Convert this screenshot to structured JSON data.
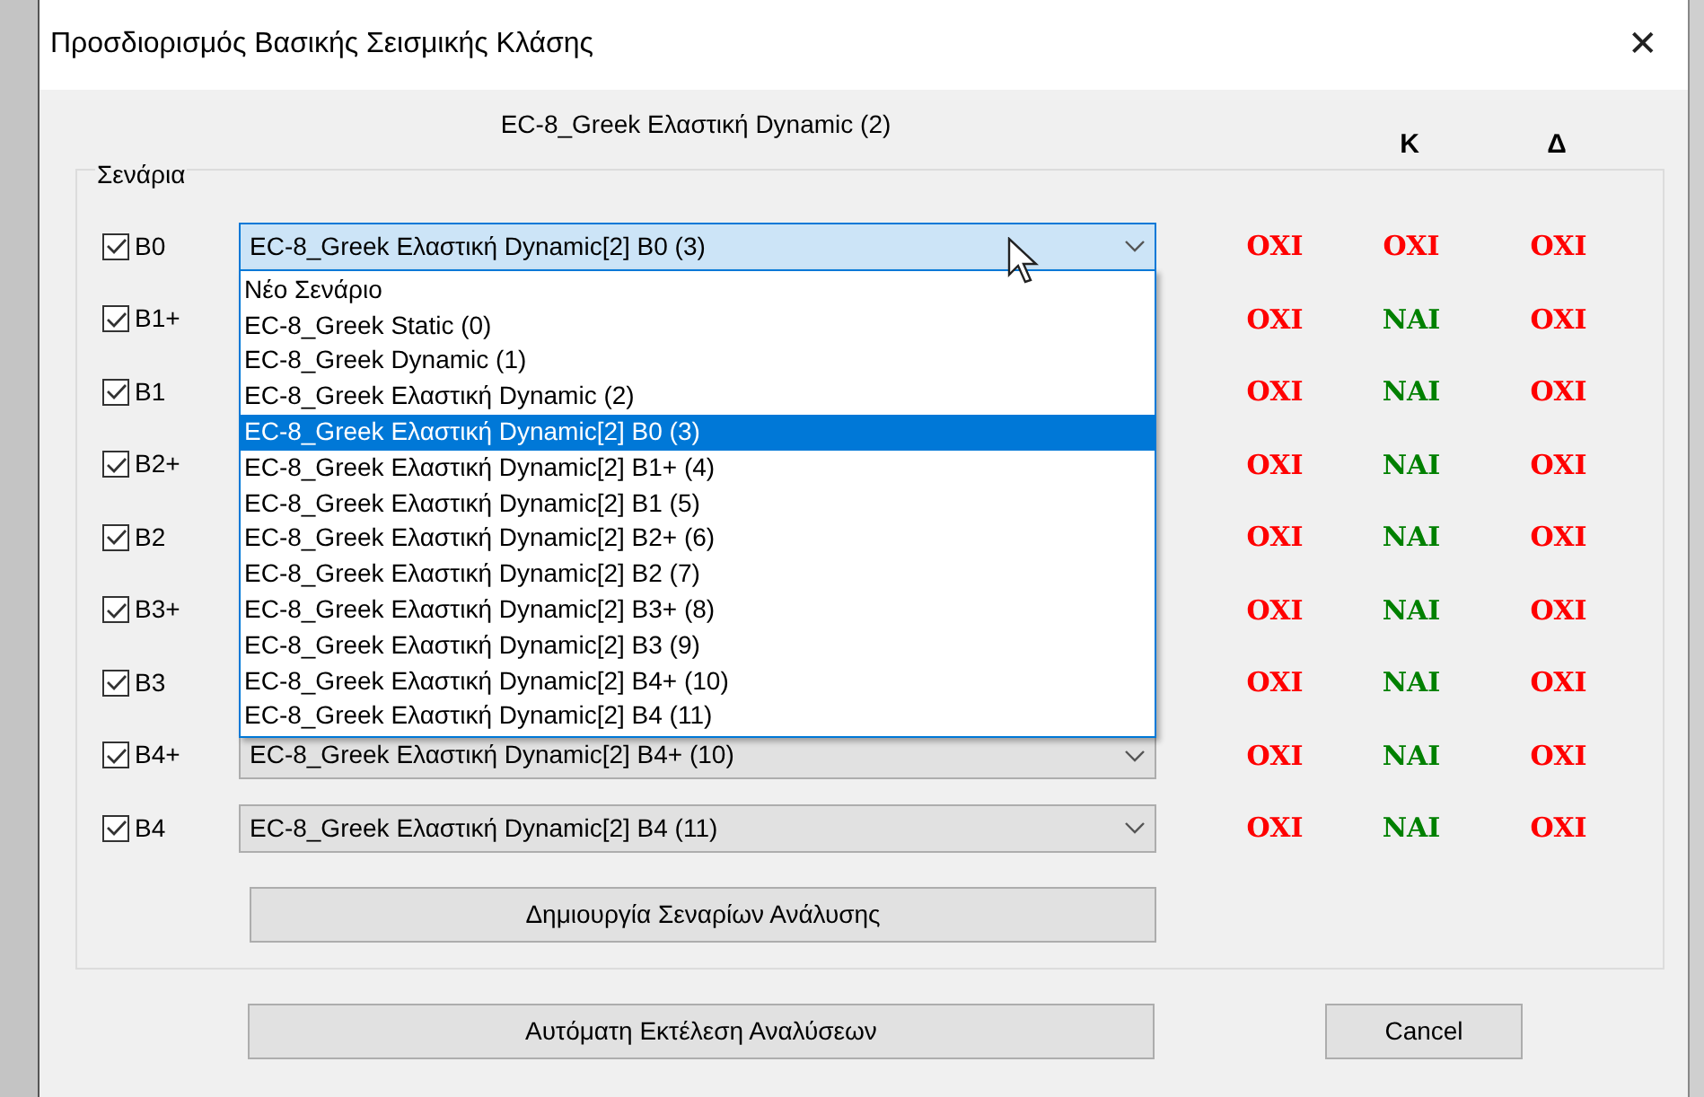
{
  "window": {
    "title": "Προσδιορισμός Βασικής Σεισμικής Κλάσης",
    "close": "✕"
  },
  "scenario_header": "EC-8_Greek Ελαστική Dynamic (2)",
  "columns": {
    "column_2": "Κ",
    "column_3": "Δ"
  },
  "group": {
    "label": "Σενάρια"
  },
  "rows": [
    {
      "label": "B0",
      "checked": true,
      "combo": "EC-8_Greek Ελαστική Dynamic[2] B0 (3)",
      "combo_open": true,
      "values": [
        {
          "text": "OXI",
          "color": "#ff0000"
        },
        {
          "text": "OXI",
          "color": "#ff0000"
        },
        {
          "text": "OXI",
          "color": "#ff0000"
        }
      ]
    },
    {
      "label": "B1+",
      "checked": true,
      "values": [
        {
          "text": "OXI",
          "color": "#ff0000"
        },
        {
          "text": "NAI",
          "color": "#008000"
        },
        {
          "text": "OXI",
          "color": "#ff0000"
        }
      ]
    },
    {
      "label": "B1",
      "checked": true,
      "values": [
        {
          "text": "OXI",
          "color": "#ff0000"
        },
        {
          "text": "NAI",
          "color": "#008000"
        },
        {
          "text": "OXI",
          "color": "#ff0000"
        }
      ]
    },
    {
      "label": "B2+",
      "checked": true,
      "values": [
        {
          "text": "OXI",
          "color": "#ff0000"
        },
        {
          "text": "NAI",
          "color": "#008000"
        },
        {
          "text": "OXI",
          "color": "#ff0000"
        }
      ]
    },
    {
      "label": "B2",
      "checked": true,
      "values": [
        {
          "text": "OXI",
          "color": "#ff0000"
        },
        {
          "text": "NAI",
          "color": "#008000"
        },
        {
          "text": "OXI",
          "color": "#ff0000"
        }
      ]
    },
    {
      "label": "B3+",
      "checked": true,
      "values": [
        {
          "text": "OXI",
          "color": "#ff0000"
        },
        {
          "text": "NAI",
          "color": "#008000"
        },
        {
          "text": "OXI",
          "color": "#ff0000"
        }
      ]
    },
    {
      "label": "B3",
      "checked": true,
      "values": [
        {
          "text": "OXI",
          "color": "#ff0000"
        },
        {
          "text": "NAI",
          "color": "#008000"
        },
        {
          "text": "OXI",
          "color": "#ff0000"
        }
      ]
    },
    {
      "label": "B4+",
      "checked": true,
      "combo": "EC-8_Greek Ελαστική Dynamic[2] B4+ (10)",
      "combo_open": false,
      "values": [
        {
          "text": "OXI",
          "color": "#ff0000"
        },
        {
          "text": "NAI",
          "color": "#008000"
        },
        {
          "text": "OXI",
          "color": "#ff0000"
        }
      ]
    },
    {
      "label": "B4",
      "checked": true,
      "combo": "EC-8_Greek Ελαστική Dynamic[2] B4 (11)",
      "combo_open": false,
      "values": [
        {
          "text": "OXI",
          "color": "#ff0000"
        },
        {
          "text": "NAI",
          "color": "#008000"
        },
        {
          "text": "OXI",
          "color": "#ff0000"
        }
      ]
    }
  ],
  "dropdown_options": [
    {
      "label": "Νέο Σενάριο",
      "selected": false
    },
    {
      "label": "EC-8_Greek Static (0)",
      "selected": false
    },
    {
      "label": "EC-8_Greek Dynamic (1)",
      "selected": false
    },
    {
      "label": "EC-8_Greek Ελαστική Dynamic (2)",
      "selected": false
    },
    {
      "label": "EC-8_Greek Ελαστική Dynamic[2] B0 (3)",
      "selected": true
    },
    {
      "label": "EC-8_Greek Ελαστική Dynamic[2] B1+ (4)",
      "selected": false
    },
    {
      "label": "EC-8_Greek Ελαστική Dynamic[2] B1 (5)",
      "selected": false
    },
    {
      "label": "EC-8_Greek Ελαστική Dynamic[2] B2+ (6)",
      "selected": false
    },
    {
      "label": "EC-8_Greek Ελαστική Dynamic[2] B2 (7)",
      "selected": false
    },
    {
      "label": "EC-8_Greek Ελαστική Dynamic[2] B3+ (8)",
      "selected": false
    },
    {
      "label": "EC-8_Greek Ελαστική Dynamic[2] B3 (9)",
      "selected": false
    },
    {
      "label": "EC-8_Greek Ελαστική Dynamic[2] B4+ (10)",
      "selected": false
    },
    {
      "label": "EC-8_Greek Ελαστική Dynamic[2] B4 (11)",
      "selected": false
    }
  ],
  "create_button": "Δημιουργία Σεναρίων Ανάλυσης",
  "buttons": [
    "Αυτόματη Εκτέλεση Αναλύσεων",
    "Cancel"
  ]
}
